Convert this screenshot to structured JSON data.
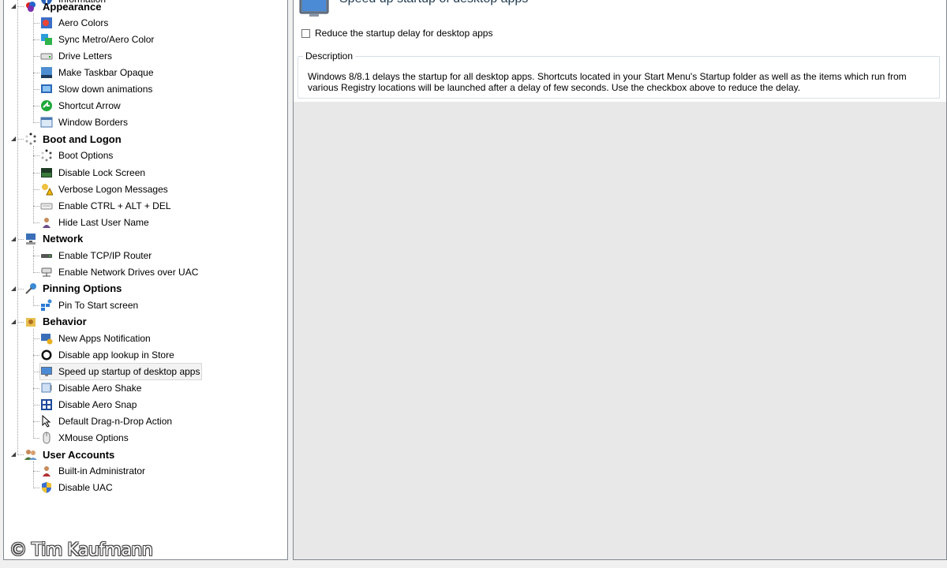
{
  "tree": {
    "partial_top_label": "Information",
    "categories": [
      {
        "label": "Appearance",
        "icon": "appearance-icon",
        "items": [
          {
            "label": "Aero Colors",
            "icon": "aero-colors-icon"
          },
          {
            "label": "Sync Metro/Aero Color",
            "icon": "sync-color-icon"
          },
          {
            "label": "Drive Letters",
            "icon": "drive-icon"
          },
          {
            "label": "Make Taskbar Opaque",
            "icon": "taskbar-icon"
          },
          {
            "label": "Slow down animations",
            "icon": "animation-icon"
          },
          {
            "label": "Shortcut Arrow",
            "icon": "shortcut-arrow-icon"
          },
          {
            "label": "Window Borders",
            "icon": "window-icon"
          }
        ]
      },
      {
        "label": "Boot and Logon",
        "icon": "boot-icon",
        "items": [
          {
            "label": "Boot Options",
            "icon": "boot-options-icon"
          },
          {
            "label": "Disable Lock Screen",
            "icon": "lock-screen-icon"
          },
          {
            "label": "Verbose Logon Messages",
            "icon": "warning-icon"
          },
          {
            "label": "Enable CTRL + ALT + DEL",
            "icon": "keyboard-icon"
          },
          {
            "label": "Hide Last User Name",
            "icon": "user-icon"
          }
        ]
      },
      {
        "label": "Network",
        "icon": "network-icon",
        "items": [
          {
            "label": "Enable TCP/IP Router",
            "icon": "router-icon"
          },
          {
            "label": "Enable Network Drives over UAC",
            "icon": "network-drive-icon"
          }
        ]
      },
      {
        "label": "Pinning Options",
        "icon": "pin-icon",
        "items": [
          {
            "label": "Pin To Start screen",
            "icon": "pin-start-icon"
          }
        ]
      },
      {
        "label": "Behavior",
        "icon": "behavior-icon",
        "items": [
          {
            "label": "New Apps Notification",
            "icon": "notification-icon"
          },
          {
            "label": "Disable app lookup in Store",
            "icon": "store-icon"
          },
          {
            "label": "Speed up startup of desktop apps",
            "icon": "monitor-icon",
            "selected": true
          },
          {
            "label": "Disable Aero Shake",
            "icon": "shake-icon"
          },
          {
            "label": "Disable Aero Snap",
            "icon": "snap-icon"
          },
          {
            "label": "Default Drag-n-Drop Action",
            "icon": "drag-drop-icon"
          },
          {
            "label": "XMouse Options",
            "icon": "mouse-icon"
          }
        ]
      },
      {
        "label": "User Accounts",
        "icon": "users-icon",
        "items": [
          {
            "label": "Built-in Administrator",
            "icon": "admin-icon"
          },
          {
            "label": "Disable UAC",
            "icon": "shield-icon"
          }
        ]
      }
    ]
  },
  "content": {
    "title": "Speed up startup of desktop apps",
    "checkbox_label": "Reduce the startup delay for desktop apps",
    "checkbox_checked": false,
    "description_legend": "Description",
    "description_text": "Windows 8/8.1 delays the startup for all desktop apps. Shortcuts located in your Start Menu's Startup folder as well as the items which run from various Registry locations will be launched after a delay of few seconds. Use the checkbox above to reduce the delay."
  },
  "watermark": "© Tim Kaufmann"
}
